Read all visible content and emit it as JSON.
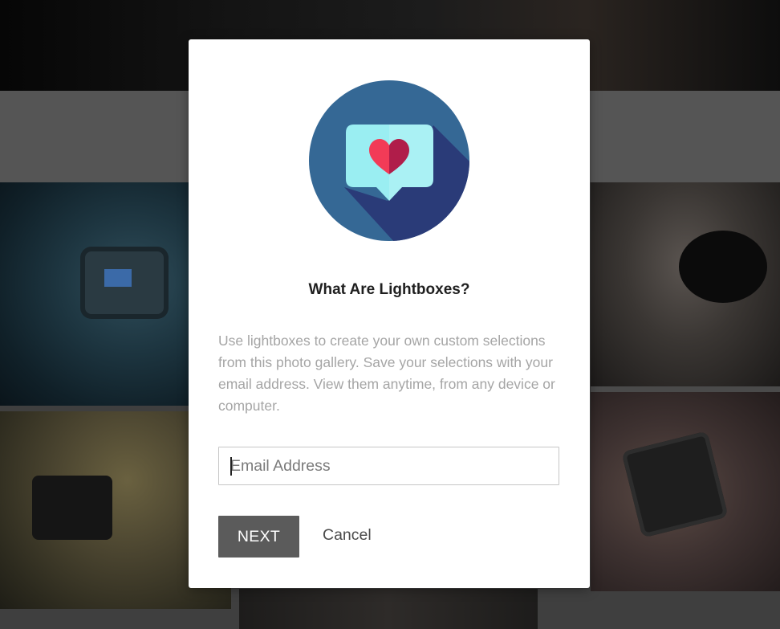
{
  "modal": {
    "icon": "lightbox-heart-speech-bubble-icon",
    "title": "What Are Lightboxes?",
    "description": "Use lightboxes to create your own custom selections from this photo gallery. Save your selections with your email address. View them anytime, from any device or computer.",
    "email_field": {
      "value": "",
      "placeholder": "Email Address"
    },
    "next_label": "NEXT",
    "cancel_label": "Cancel"
  },
  "colors": {
    "circle": "#356895",
    "shadow": "#2a3b78",
    "bubble": "#9aeef2",
    "heart_left": "#f23b57",
    "heart_right": "#b01d4a",
    "button": "#5b5b5b"
  }
}
